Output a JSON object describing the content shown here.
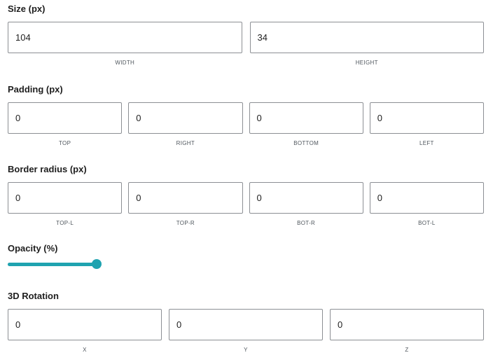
{
  "size": {
    "title": "Size (px)",
    "fields": [
      {
        "value": "104",
        "label": "WIDTH"
      },
      {
        "value": "34",
        "label": "HEIGHT"
      }
    ]
  },
  "padding": {
    "title": "Padding (px)",
    "fields": [
      {
        "value": "0",
        "label": "TOP"
      },
      {
        "value": "0",
        "label": "RIGHT"
      },
      {
        "value": "0",
        "label": "BOTTOM"
      },
      {
        "value": "0",
        "label": "LEFT"
      }
    ]
  },
  "border_radius": {
    "title": "Border radius (px)",
    "fields": [
      {
        "value": "0",
        "label": "TOP-L"
      },
      {
        "value": "0",
        "label": "TOP-R"
      },
      {
        "value": "0",
        "label": "BOT-R"
      },
      {
        "value": "0",
        "label": "BOT-L"
      }
    ]
  },
  "opacity": {
    "title": "Opacity (%)",
    "value_percent": 100,
    "accent_color": "#1fa3b0"
  },
  "rotation": {
    "title": "3D Rotation",
    "fields": [
      {
        "value": "0",
        "label": "X"
      },
      {
        "value": "0",
        "label": "Y"
      },
      {
        "value": "0",
        "label": "Z"
      }
    ]
  }
}
